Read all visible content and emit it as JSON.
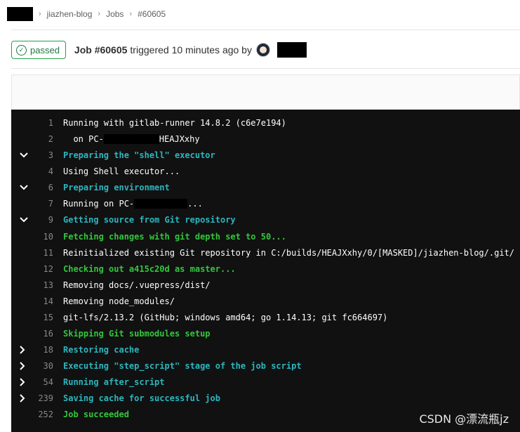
{
  "breadcrumb": {
    "items": [
      "jiazhen-blog",
      "Jobs",
      "#60605"
    ]
  },
  "job": {
    "status": "passed",
    "title": "Job #60605",
    "meta": "triggered 10 minutes ago by"
  },
  "log": {
    "lines": [
      {
        "num": "1",
        "text": "Running with gitlab-runner 14.8.2 (c6e7e194)",
        "style": "white",
        "toggle": ""
      },
      {
        "num": "2",
        "pre": "  on PC-",
        "redact": true,
        "post": "HEAJXxhy",
        "style": "white",
        "toggle": ""
      },
      {
        "num": "3",
        "text": "Preparing the \"shell\" executor",
        "style": "cyan",
        "toggle": "down"
      },
      {
        "num": "4",
        "text": "Using Shell executor...",
        "style": "white",
        "toggle": ""
      },
      {
        "num": "6",
        "text": "Preparing environment",
        "style": "cyan",
        "toggle": "down"
      },
      {
        "num": "7",
        "pre": "Running on PC-",
        "redact": true,
        "post": "...",
        "style": "white",
        "toggle": ""
      },
      {
        "num": "9",
        "text": "Getting source from Git repository",
        "style": "cyan",
        "toggle": "down"
      },
      {
        "num": "10",
        "text": "Fetching changes with git depth set to 50...",
        "style": "green",
        "toggle": ""
      },
      {
        "num": "11",
        "text": "Reinitialized existing Git repository in C:/builds/HEAJXxhy/0/[MASKED]/jiazhen-blog/.git/",
        "style": "white",
        "toggle": ""
      },
      {
        "num": "12",
        "text": "Checking out a415c20d as master...",
        "style": "green",
        "toggle": ""
      },
      {
        "num": "13",
        "text": "Removing docs/.vuepress/dist/",
        "style": "white",
        "toggle": ""
      },
      {
        "num": "14",
        "text": "Removing node_modules/",
        "style": "white",
        "toggle": ""
      },
      {
        "num": "15",
        "text": "git-lfs/2.13.2 (GitHub; windows amd64; go 1.14.13; git fc664697)",
        "style": "white",
        "toggle": ""
      },
      {
        "num": "16",
        "text": "Skipping Git submodules setup",
        "style": "green",
        "toggle": ""
      },
      {
        "num": "18",
        "text": "Restoring cache",
        "style": "cyan",
        "toggle": "right"
      },
      {
        "num": "30",
        "text": "Executing \"step_script\" stage of the job script",
        "style": "cyan",
        "toggle": "right"
      },
      {
        "num": "54",
        "text": "Running after_script",
        "style": "cyan",
        "toggle": "right"
      },
      {
        "num": "239",
        "text": "Saving cache for successful job",
        "style": "cyan",
        "toggle": "right"
      },
      {
        "num": "252",
        "text": "Job succeeded",
        "style": "green",
        "toggle": ""
      }
    ]
  },
  "watermark": "CSDN @漂流瓶jz"
}
